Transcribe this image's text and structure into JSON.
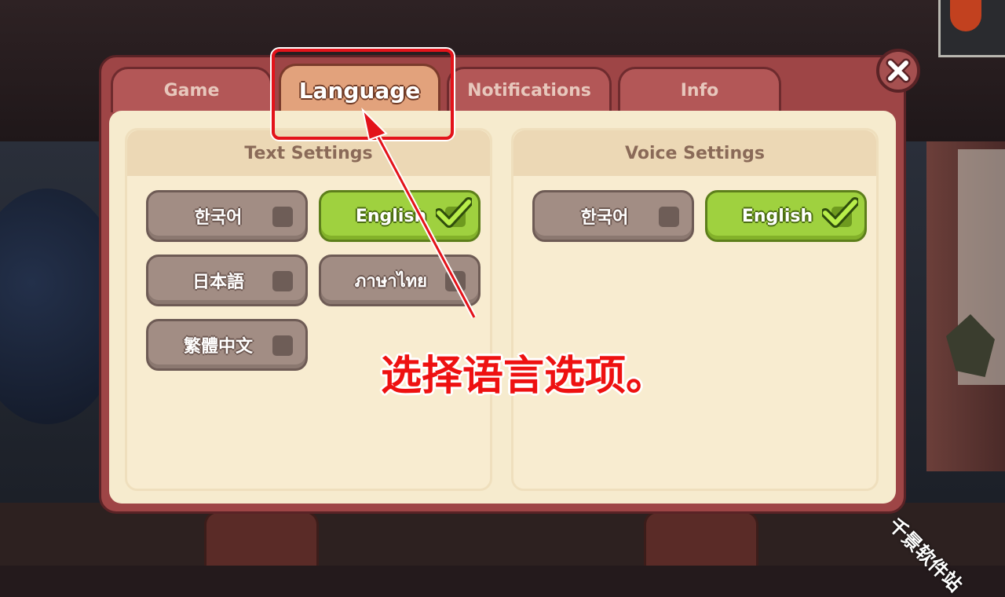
{
  "tabs": [
    {
      "label": "Game",
      "active": false
    },
    {
      "label": "Language",
      "active": true
    },
    {
      "label": "Notifications",
      "active": false
    },
    {
      "label": "Info",
      "active": false
    }
  ],
  "text_settings": {
    "title": "Text Settings",
    "options": [
      {
        "label": "한국어",
        "selected": false
      },
      {
        "label": "English",
        "selected": true
      },
      {
        "label": "日本語",
        "selected": false
      },
      {
        "label": "ภาษาไทย",
        "selected": false
      },
      {
        "label": "繁體中文",
        "selected": false
      }
    ]
  },
  "voice_settings": {
    "title": "Voice Settings",
    "options": [
      {
        "label": "한국어",
        "selected": false
      },
      {
        "label": "English",
        "selected": true
      }
    ]
  },
  "close_icon": "close-x-icon",
  "annotation": {
    "caption": "选择语言选项。",
    "highlight_color": "#e3131a"
  },
  "watermark": "千景软件站",
  "colors": {
    "panel_frame": "#9e4546",
    "panel_body": "#f6ebce",
    "active_tab": "#e2a27c",
    "selected_option": "#9fd13f",
    "unselected_option": "#a28d84"
  }
}
